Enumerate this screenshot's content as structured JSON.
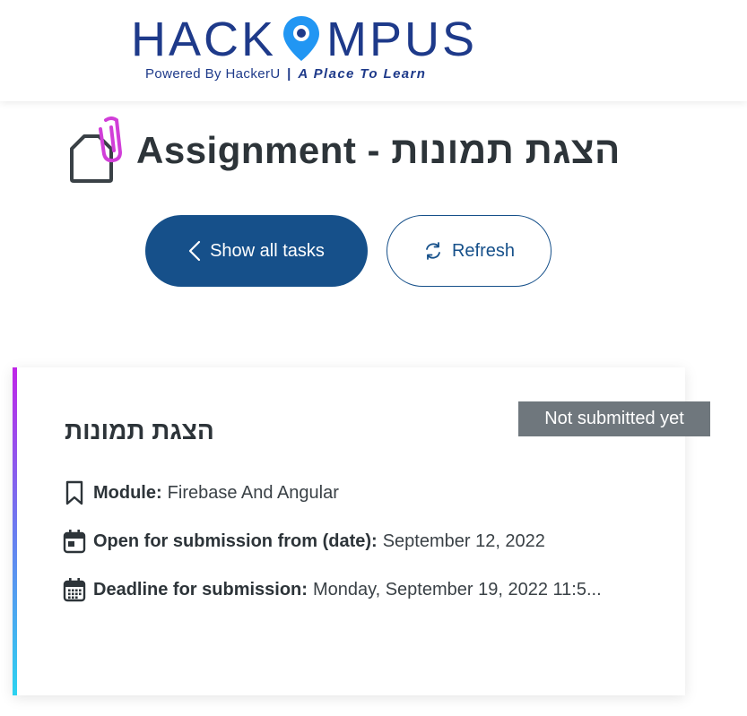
{
  "header": {
    "logo_text": "HACKAMPUS",
    "logo_powered": "Powered By HackerU",
    "logo_separator": "|",
    "logo_slogan": "A Place To Learn"
  },
  "page": {
    "title": "Assignment - הצגת תמונות"
  },
  "actions": {
    "show_all_label": "Show all tasks",
    "refresh_label": "Refresh"
  },
  "card": {
    "status": "Not submitted yet",
    "title": "הצגת תמונות",
    "module_label": "Module:",
    "module_value": "Firebase And Angular",
    "open_label": "Open for submission from (date):",
    "open_value": "September 12, 2022",
    "deadline_label": "Deadline for submission:",
    "deadline_value": "Monday, September 19, 2022 11:5..."
  },
  "colors": {
    "primary": "#16508a",
    "logo_blue": "#1e3a8a",
    "logo_pin": "#2196f3",
    "badge_bg": "#6f777d",
    "accent_top": "#c025e8",
    "accent_bottom": "#2cd3f0",
    "doc_icon_clip": "#d13ed8"
  },
  "icons": {
    "doc": "document-with-paperclip-icon",
    "back": "chevron-left-icon",
    "refresh": "refresh-icon",
    "module": "bookmark-icon",
    "open": "calendar-icon",
    "deadline": "calendar-grid-icon"
  }
}
